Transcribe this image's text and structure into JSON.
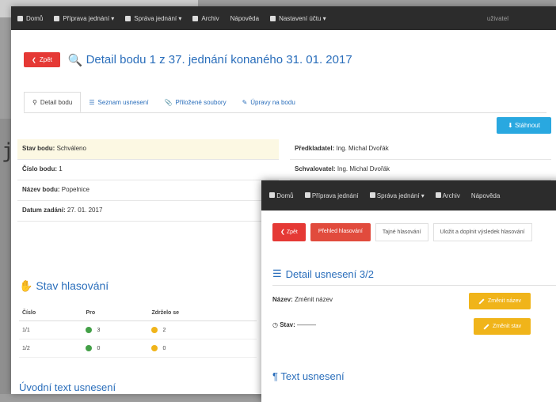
{
  "back_window": {
    "nav": {
      "home": "Domů",
      "priprava": "Příprava jednání ▾",
      "sprava": "Správa jednání ▾",
      "archiv": "Archiv",
      "napoveda": "Nápověda",
      "nastaveni": "Nastavení účtu ▾",
      "user": "uživatel"
    },
    "back_label": "Zpět",
    "page_title": "Detail bodu 1 z 37. jednání konaného 31. 01. 2017",
    "tabs": [
      "Detail bodu",
      "Seznam usnesení",
      "Přiložené soubory",
      "Úpravy na bodu"
    ],
    "download_label": "Stáhnout",
    "info_left": [
      {
        "label": "Stav bodu:",
        "value": "Schváleno"
      },
      {
        "label": "Číslo bodu:",
        "value": "1"
      },
      {
        "label": "Název bodu:",
        "value": "Popelnice"
      },
      {
        "label": "Datum zadání:",
        "value": "27. 01. 2017"
      }
    ],
    "info_right": [
      {
        "label": "Předkladatel:",
        "value": "Ing. Michal Dvořák"
      },
      {
        "label": "Schvalovatel:",
        "value": "Ing. Michal Dvořák"
      }
    ],
    "voting_title": "Stav hlasování",
    "voting_headers": [
      "Číslo",
      "Pro",
      "Zdrželo se"
    ],
    "voting_rows": [
      {
        "id": "1/1",
        "pro": "3",
        "zdrzelo": "2"
      },
      {
        "id": "1/2",
        "pro": "0",
        "zdrzelo": "0"
      }
    ],
    "intro_title": "Úvodní text usnesení"
  },
  "front_window": {
    "nav": {
      "home": "Domů",
      "priprava": "Příprava jednání",
      "sprava": "Správa jednání ▾",
      "archiv": "Archiv",
      "napoveda": "Nápověda"
    },
    "buttons": {
      "back": "Zpět",
      "prehled": "Přehled hlasování",
      "tajne": "Tajné hlasování",
      "ulozit": "Uložit a doplnit výsledek hlasování"
    },
    "detail_title": "Detail usnesení 3/2",
    "nazev_label": "Název:",
    "nazev_value": "Změnit název",
    "stav_label": "Stav:",
    "stav_value": "———",
    "change_name_label": "Změnit název",
    "change_state_label": "Změnit stav",
    "text_title": "Text usnesení"
  },
  "stray_char": "j",
  "colors": {
    "accent_blue": "#2a6ebb",
    "danger_red": "#e53935",
    "warning_yellow": "#f0b41a",
    "info_blue": "#29a8e0",
    "navbar": "#2c2c2c"
  }
}
